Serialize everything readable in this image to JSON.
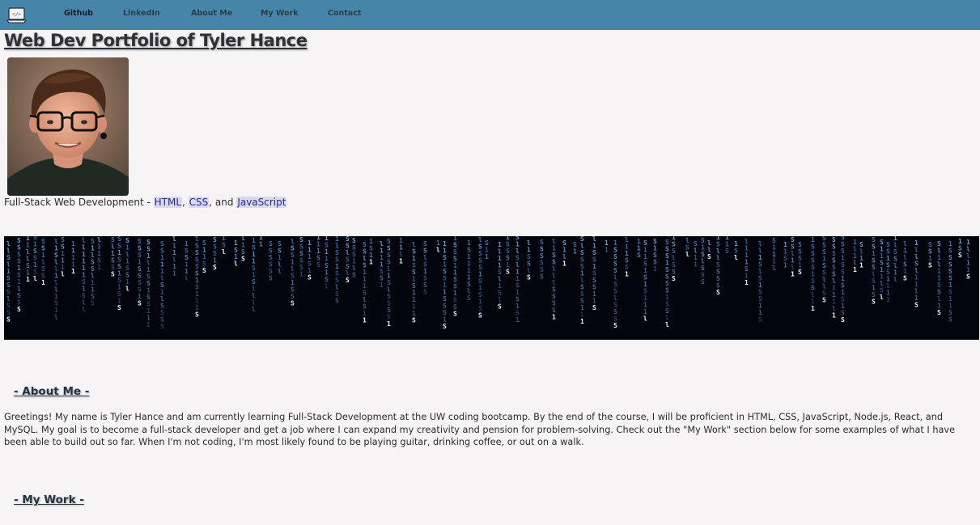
{
  "nav": {
    "logo_icon": "code-laptop-icon",
    "links": [
      "Github",
      "LinkedIn",
      "About Me",
      "My Work",
      "Contact"
    ],
    "bg_color": "#4684a8"
  },
  "header": {
    "title": "Web Dev Portfolio of Tyler Hance"
  },
  "profile": {
    "photo": "profile-photo",
    "tagline_prefix": "Full-Stack Web Development - ",
    "skills": [
      "HTML",
      "CSS",
      "JavaScript"
    ],
    "sep1": ", ",
    "sep2": ", and "
  },
  "banner": {
    "image": "matrix-code-rain-banner"
  },
  "about": {
    "heading": "- About Me -",
    "text": "Greetings! My name is Tyler Hance and am currently learning Full-Stack Development at the UW coding bootcamp. By the end of the course, I will be proficient in HTML, CSS, JavaScript, Node.js, React, and MySQL. My goal is to become a full-stack developer and get a job where I can expand my creativity and pension for problem-solving. Check out the \"My Work\" section below for some examples of what I have been able to build out so far. When I'm not coding, I'm most likely found to be playing guitar, drinking coffee, or out on a walk."
  },
  "work": {
    "heading": "- My Work -"
  }
}
